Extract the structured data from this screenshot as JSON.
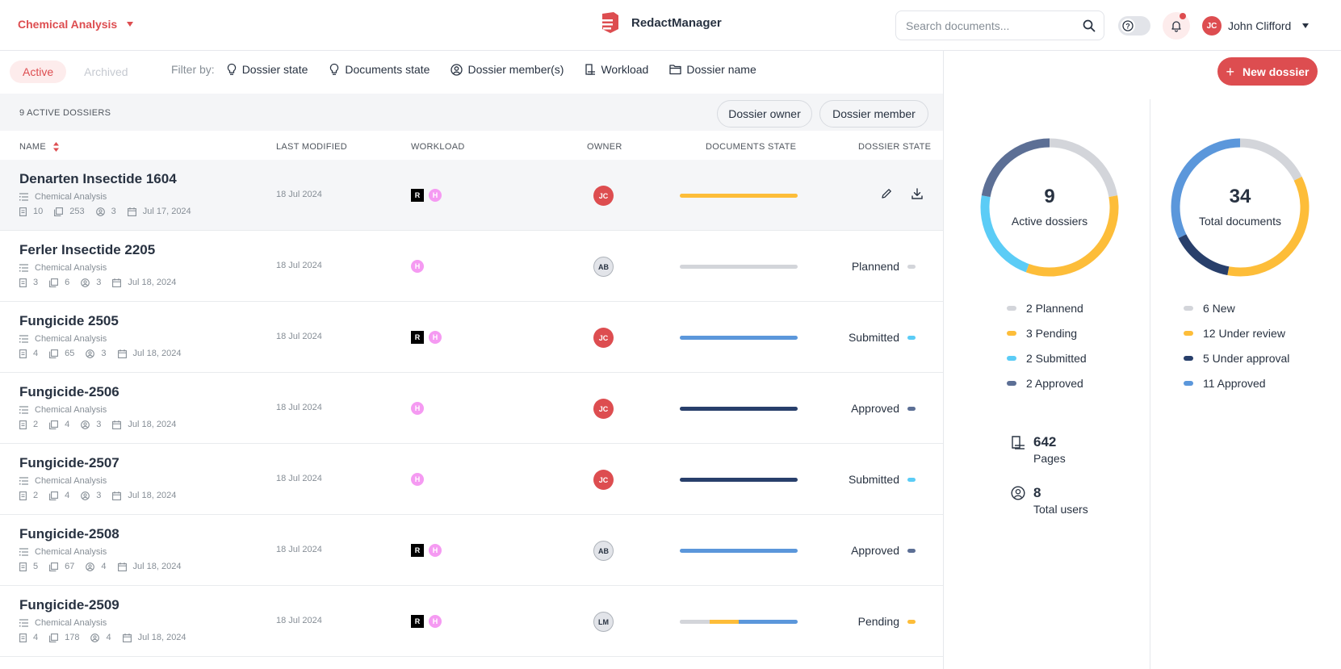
{
  "header": {
    "app_name": "Chemical Analysis",
    "brand": "RedactManager",
    "search_placeholder": "Search documents...",
    "user_initials": "JC",
    "user_name": "John Clifford"
  },
  "toolbar": {
    "tab_active": "Active",
    "tab_archived": "Archived",
    "filter_label": "Filter by:",
    "filters": [
      "Dossier state",
      "Documents state",
      "Dossier member(s)",
      "Workload",
      "Dossier name"
    ],
    "new_dossier": "New dossier"
  },
  "list": {
    "count_label": "9 ACTIVE DOSSIERS",
    "chip_owner": "Dossier owner",
    "chip_member": "Dossier member",
    "columns": {
      "name": "NAME",
      "modified": "LAST MODIFIED",
      "workload": "WORKLOAD",
      "owner": "OWNER",
      "docs_state": "DOCUMENTS STATE",
      "dossier_state": "DOSSIER STATE"
    },
    "rows": [
      {
        "name": "Denarten Insectide 1604",
        "template": "Chemical Analysis",
        "docs": "10",
        "pages": "253",
        "members": "3",
        "date": "Jul 17, 2024",
        "modified": "18 Jul 2024",
        "workload": [
          "R",
          "H"
        ],
        "owner": "JC",
        "owner_style": "red",
        "docs_bar": [
          {
            "color": "#fdbd39",
            "share": 1
          }
        ],
        "state": "",
        "state_color": "",
        "hovered": true
      },
      {
        "name": "Ferler Insectide 2205",
        "template": "Chemical Analysis",
        "docs": "3",
        "pages": "6",
        "members": "3",
        "date": "Jul 18, 2024",
        "modified": "18 Jul 2024",
        "workload": [
          "H"
        ],
        "owner": "AB",
        "owner_style": "grey",
        "docs_bar": [
          {
            "color": "#d3d5da",
            "share": 1
          }
        ],
        "state": "Plannend",
        "state_color": "#d3d5da"
      },
      {
        "name": "Fungicide 2505",
        "template": "Chemical Analysis",
        "docs": "4",
        "pages": "65",
        "members": "3",
        "date": "Jul 18, 2024",
        "modified": "18 Jul 2024",
        "workload": [
          "R",
          "H"
        ],
        "owner": "JC",
        "owner_style": "red",
        "docs_bar": [
          {
            "color": "#5b97db",
            "share": 1
          }
        ],
        "state": "Submitted",
        "state_color": "#5bccf6"
      },
      {
        "name": "Fungicide-2506",
        "template": "Chemical Analysis",
        "docs": "2",
        "pages": "4",
        "members": "3",
        "date": "Jul 18, 2024",
        "modified": "18 Jul 2024",
        "workload": [
          "H"
        ],
        "owner": "JC",
        "owner_style": "red",
        "docs_bar": [
          {
            "color": "#283f6b",
            "share": 1
          }
        ],
        "state": "Approved",
        "state_color": "#5c6f95"
      },
      {
        "name": "Fungicide-2507",
        "template": "Chemical Analysis",
        "docs": "2",
        "pages": "4",
        "members": "3",
        "date": "Jul 18, 2024",
        "modified": "18 Jul 2024",
        "workload": [
          "H"
        ],
        "owner": "JC",
        "owner_style": "red",
        "docs_bar": [
          {
            "color": "#283f6b",
            "share": 1
          }
        ],
        "state": "Submitted",
        "state_color": "#5bccf6"
      },
      {
        "name": "Fungicide-2508",
        "template": "Chemical Analysis",
        "docs": "5",
        "pages": "67",
        "members": "4",
        "date": "Jul 18, 2024",
        "modified": "18 Jul 2024",
        "workload": [
          "R",
          "H"
        ],
        "owner": "AB",
        "owner_style": "grey",
        "docs_bar": [
          {
            "color": "#5b97db",
            "share": 1
          }
        ],
        "state": "Approved",
        "state_color": "#5c6f95"
      },
      {
        "name": "Fungicide-2509",
        "template": "Chemical Analysis",
        "docs": "4",
        "pages": "178",
        "members": "4",
        "date": "Jul 18, 2024",
        "modified": "18 Jul 2024",
        "workload": [
          "R",
          "H"
        ],
        "owner": "LM",
        "owner_style": "grey",
        "docs_bar": [
          {
            "color": "#d3d5da",
            "share": 0.25
          },
          {
            "color": "#fdbd39",
            "share": 0.25
          },
          {
            "color": "#5b97db",
            "share": 0.5
          }
        ],
        "state": "Pending",
        "state_color": "#fdbd39"
      }
    ]
  },
  "stats": {
    "dossiers": {
      "value": "9",
      "label": "Active dossiers",
      "segments": [
        {
          "label": "2 Plannend",
          "count": 2,
          "color": "#d3d5da"
        },
        {
          "label": "3 Pending",
          "count": 3,
          "color": "#fdbd39"
        },
        {
          "label": "2 Submitted",
          "count": 2,
          "color": "#5bccf6"
        },
        {
          "label": "2 Approved",
          "count": 2,
          "color": "#5c6f95"
        }
      ]
    },
    "documents": {
      "value": "34",
      "label": "Total documents",
      "segments": [
        {
          "label": "6 New",
          "count": 6,
          "color": "#d3d5da"
        },
        {
          "label": "12 Under review",
          "count": 12,
          "color": "#fdbd39"
        },
        {
          "label": "5 Under approval",
          "count": 5,
          "color": "#283f6b"
        },
        {
          "label": "11 Approved",
          "count": 11,
          "color": "#5b97db"
        }
      ]
    },
    "pages_value": "642",
    "pages_label": "Pages",
    "users_value": "8",
    "users_label": "Total users"
  },
  "colors": {
    "accent": "#dd4d50",
    "text": "#283241",
    "muted": "#868e96"
  }
}
